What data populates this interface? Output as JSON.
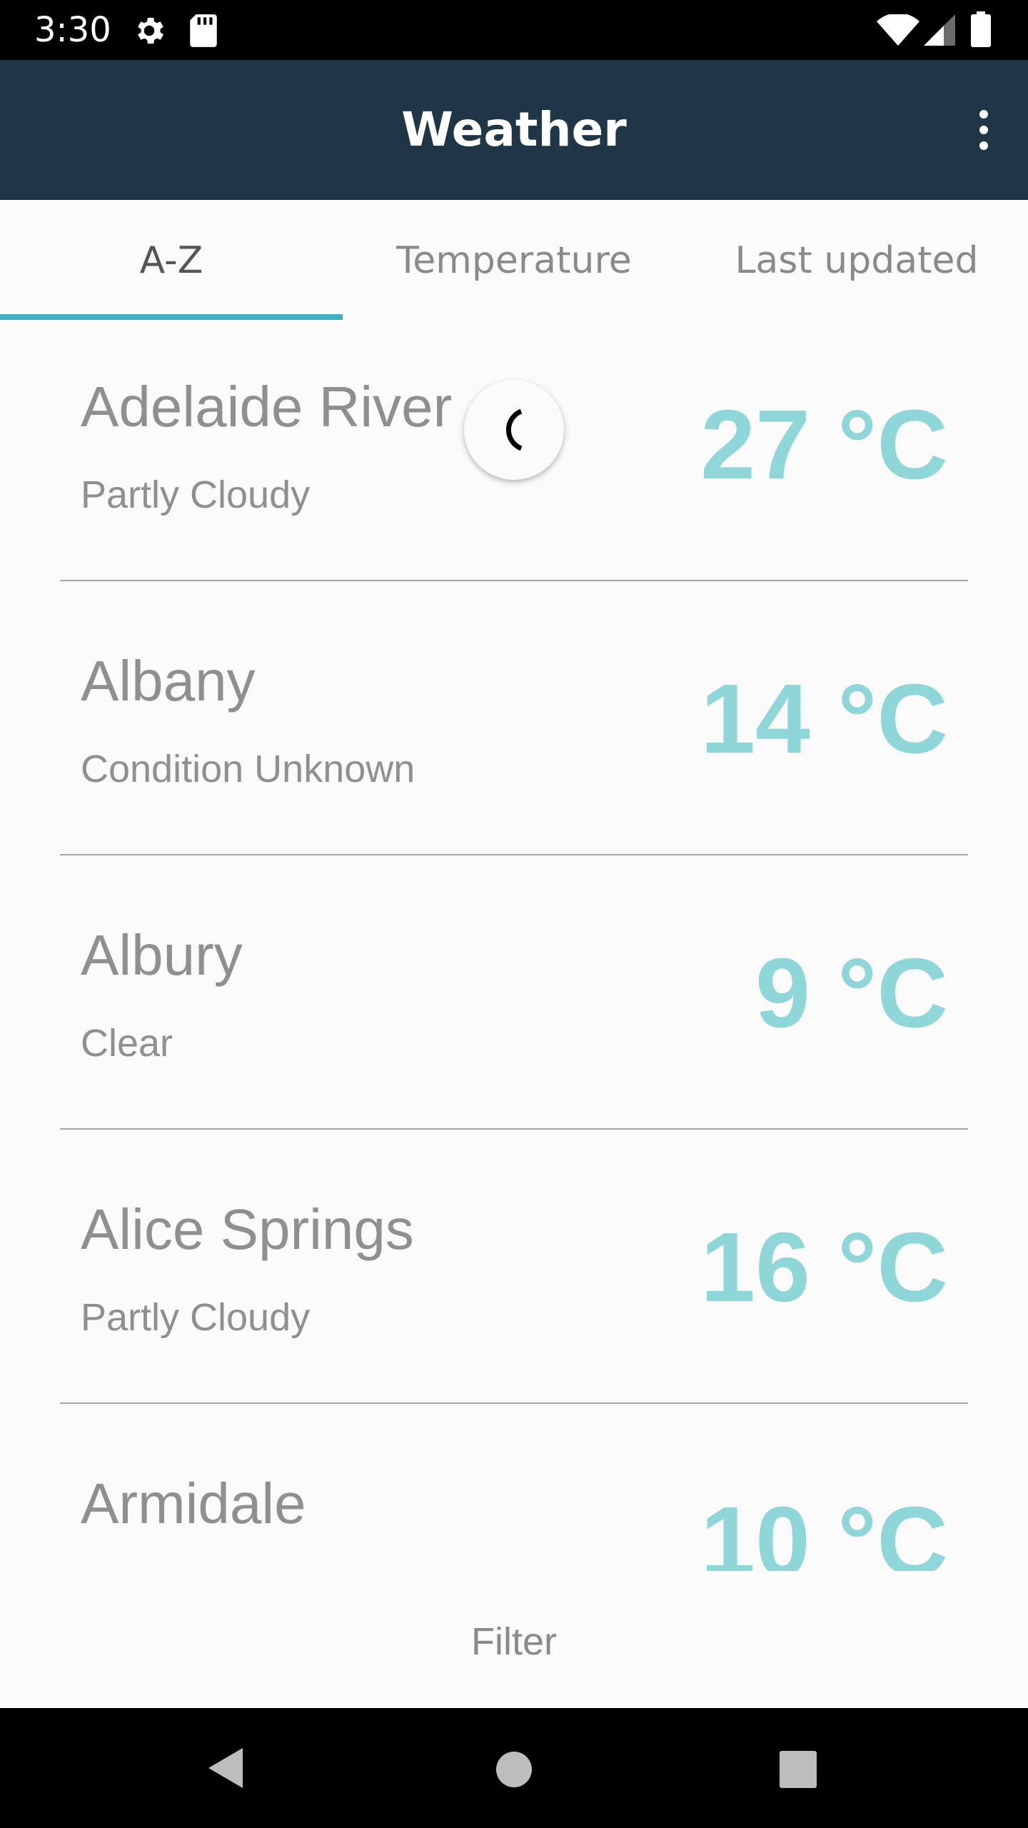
{
  "status_bar": {
    "time": "3:30",
    "icons": [
      "gear-icon",
      "sd-card-icon",
      "wifi-icon",
      "signal-icon",
      "battery-icon"
    ]
  },
  "app_bar": {
    "title": "Weather",
    "menu_icon": "more-vert-icon"
  },
  "tabs": [
    {
      "label": "A-Z",
      "active": true
    },
    {
      "label": "Temperature",
      "active": false
    },
    {
      "label": "Last updated",
      "active": false
    }
  ],
  "locations": [
    {
      "name": "Adelaide River",
      "condition": "Partly Cloudy",
      "temperature": "27 °C"
    },
    {
      "name": "Albany",
      "condition": "Condition Unknown",
      "temperature": "14 °C"
    },
    {
      "name": "Albury",
      "condition": "Clear",
      "temperature": "9 °C"
    },
    {
      "name": "Alice Springs",
      "condition": "Partly Cloudy",
      "temperature": "16 °C"
    },
    {
      "name": "Armidale",
      "condition": "",
      "temperature": "10 °C"
    }
  ],
  "filter": {
    "label": "Filter"
  },
  "colors": {
    "app_bar": "#1e3645",
    "accent": "#3fb0c0",
    "temperature": "#8fd6d9",
    "text_secondary": "#8f8f8f"
  },
  "nav_bar": {
    "icons": [
      "back-icon",
      "home-icon",
      "recents-icon"
    ]
  }
}
